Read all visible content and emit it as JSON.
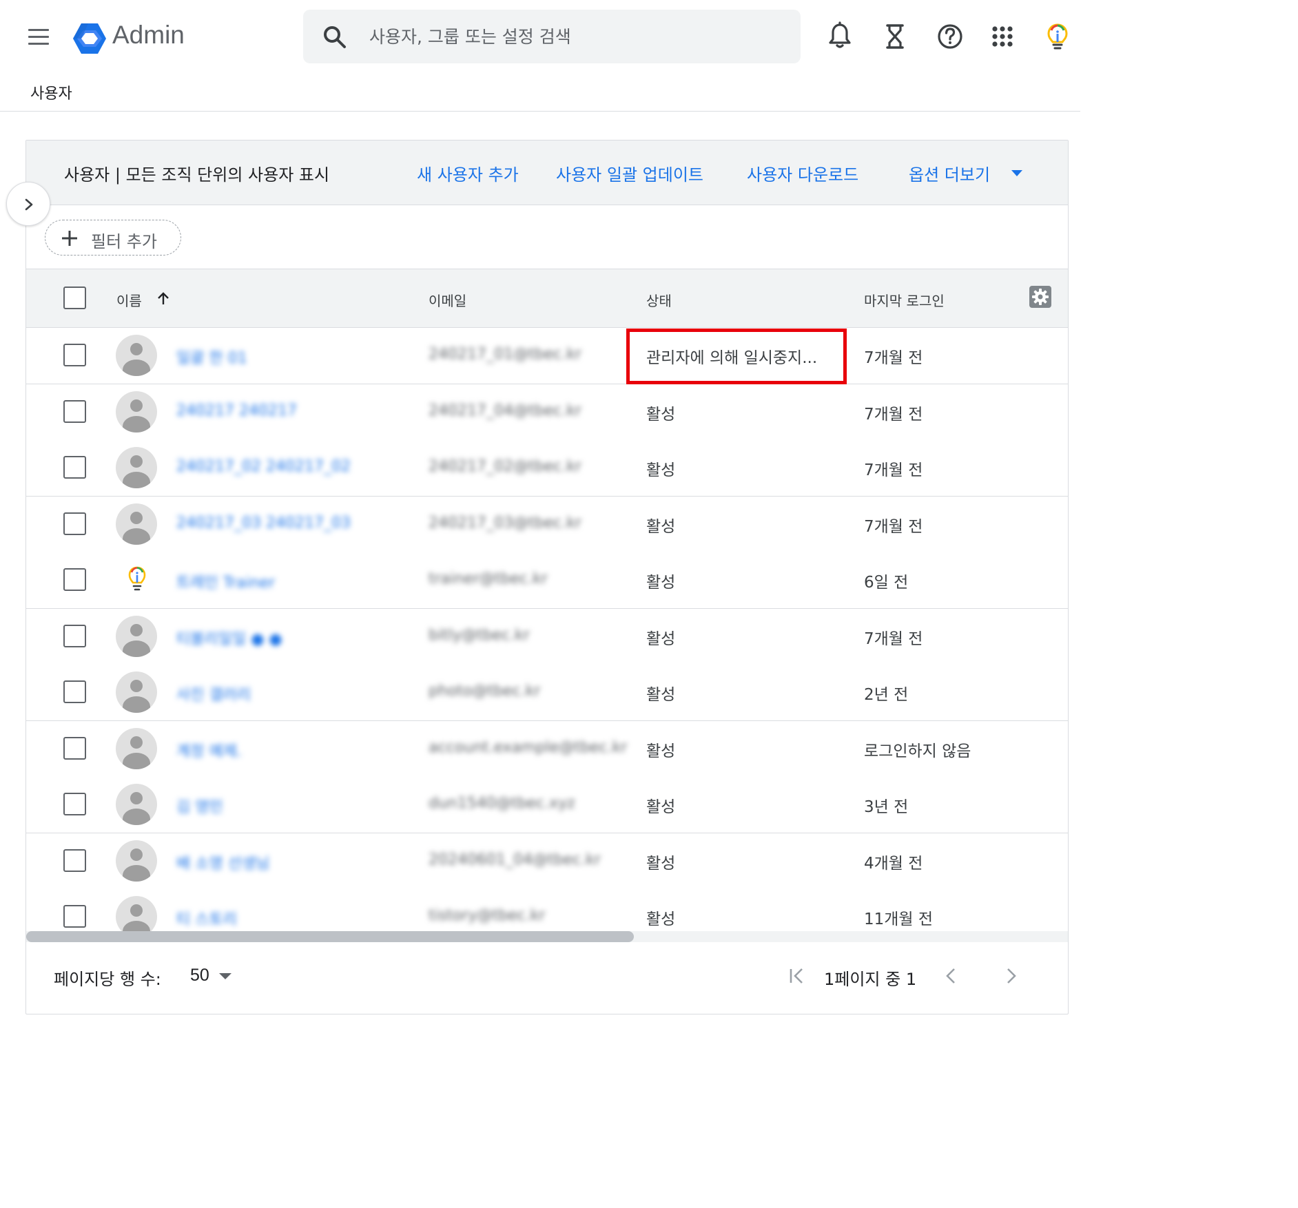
{
  "app": {
    "title": "Admin"
  },
  "search": {
    "placeholder": "사용자, 그룹 또는 설정 검색"
  },
  "top_icons": [
    "bell-icon",
    "hourglass-icon",
    "help-icon",
    "apps-grid-icon",
    "lightbulb-icon"
  ],
  "page_heading": "사용자",
  "card": {
    "title": "사용자 | 모든 조직 단위의 사용자 표시",
    "actions": {
      "add_user": "새 사용자 추가",
      "bulk_update": "사용자 일괄 업데이트",
      "download": "사용자 다운로드",
      "more_options": "옵션 더보기"
    },
    "filter_label": "필터 추가"
  },
  "table": {
    "headers": {
      "name": "이름",
      "email": "이메일",
      "status": "상태",
      "last_login": "마지막 로그인"
    },
    "rows": [
      {
        "name": "일괄 한 01",
        "email": "240217_01@tbec.kr",
        "status": "관리자에 의해 일시중지...",
        "last_login": "7개월 전",
        "avatar": "default"
      },
      {
        "name": "240217 240217",
        "email": "240217_04@tbec.kr",
        "status": "활성",
        "last_login": "7개월 전",
        "avatar": "default"
      },
      {
        "name": "240217_02 240217_02",
        "email": "240217_02@tbec.kr",
        "status": "활성",
        "last_login": "7개월 전",
        "avatar": "default"
      },
      {
        "name": "240217_03 240217_03",
        "email": "240217_03@tbec.kr",
        "status": "활성",
        "last_login": "7개월 전",
        "avatar": "default"
      },
      {
        "name": "트레인 Trainer",
        "email": "trainer@tbec.kr",
        "status": "활성",
        "last_login": "6일 전",
        "avatar": "bulb"
      },
      {
        "name": "티볼리일일 ● ●",
        "email": "bitly@tbec.kr",
        "status": "활성",
        "last_login": "7개월 전",
        "avatar": "default"
      },
      {
        "name": "사진 갤러리",
        "email": "photo@tbec.kr",
        "status": "활성",
        "last_login": "2년 전",
        "avatar": "default"
      },
      {
        "name": "계정 예제.",
        "email": "account.example@tbec.kr",
        "status": "활성",
        "last_login": "로그인하지 않음",
        "avatar": "default"
      },
      {
        "name": "김 영민",
        "email": "dun1540@tbec.xyz",
        "status": "활성",
        "last_login": "3년 전",
        "avatar": "default"
      },
      {
        "name": "배 소영 선생님",
        "email": "20240601_04@tbec.kr",
        "status": "활성",
        "last_login": "4개월 전",
        "avatar": "default"
      },
      {
        "name": "티 스토리",
        "email": "tistory@tbec.kr",
        "status": "활성",
        "last_login": "11개월 전",
        "avatar": "default"
      }
    ]
  },
  "footer": {
    "rows_per_page_label": "페이지당 행 수:",
    "rows_per_page_value": "50",
    "page_info": "1페이지 중 1"
  },
  "colors": {
    "link": "#1a73e8",
    "highlight": "#e8000b",
    "header_bg": "#f1f3f4"
  }
}
